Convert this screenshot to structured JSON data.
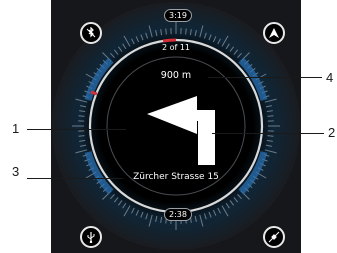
{
  "top_time": "3:19",
  "bottom_time": "2:38",
  "step": "2 of 11",
  "distance": "900 m",
  "street": "Zürcher Strasse 15",
  "callouts": [
    "1",
    "2",
    "3",
    "4"
  ],
  "icons": {
    "top_left": "bluetooth-off-icon",
    "top_right": "navigation-icon",
    "bottom_left": "usb-icon",
    "bottom_right": "satellite-icon"
  },
  "colors": {
    "ring": "#d9d9d9",
    "accent_red": "#d4303a",
    "dial_blue": "#2a6fb0"
  }
}
